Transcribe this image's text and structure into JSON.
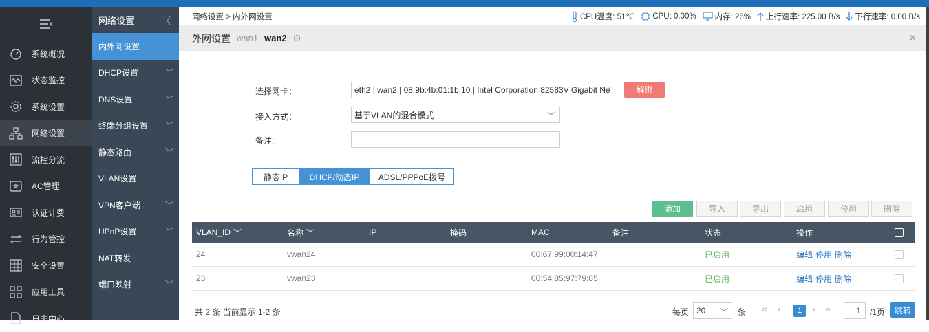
{
  "sidebar": {
    "items": [
      {
        "label": "系统概况",
        "icon": "dashboard-icon"
      },
      {
        "label": "状态监控",
        "icon": "monitor-icon"
      },
      {
        "label": "系统设置",
        "icon": "gear-icon"
      },
      {
        "label": "网络设置",
        "icon": "network-icon"
      },
      {
        "label": "流控分流",
        "icon": "sliders-icon"
      },
      {
        "label": "AC管理",
        "icon": "wifi-icon"
      },
      {
        "label": "认证计费",
        "icon": "id-card-icon"
      },
      {
        "label": "行为管控",
        "icon": "arrows-icon"
      },
      {
        "label": "安全设置",
        "icon": "grid-icon"
      },
      {
        "label": "应用工具",
        "icon": "apps-icon"
      },
      {
        "label": "日志中心",
        "icon": "document-icon"
      }
    ]
  },
  "submenu": {
    "title": "网络设置",
    "items": [
      {
        "label": "内外网设置"
      },
      {
        "label": "DHCP设置"
      },
      {
        "label": "DNS设置"
      },
      {
        "label": "终端分组设置"
      },
      {
        "label": "静态路由"
      },
      {
        "label": "VLAN设置"
      },
      {
        "label": "VPN客户端"
      },
      {
        "label": "UPnP设置"
      },
      {
        "label": "NAT转发"
      },
      {
        "label": "端口映射"
      }
    ]
  },
  "topbar": {
    "breadcrumb": "网络设置 > 内外网设置",
    "cpu_temp": "CPU温度: 51℃",
    "cpu": "CPU: 0.00%",
    "memory": "内存: 26%",
    "upload": "上行速率: 225.00 B/s",
    "download": "下行速率: 0.00 B/s"
  },
  "panel": {
    "title": "外网设置",
    "tab1": "wan1",
    "tab2": "wan2",
    "add_symbol": "⊕",
    "close_symbol": "×"
  },
  "form": {
    "nic_label": "选择网卡：",
    "nic_value": "eth2 | wan2 | 08:9b:4b:01:1b:10 | Intel Corporation 82583V Gigabit Ne",
    "unbind_label": "解绑",
    "access_label": "接入方式：",
    "access_value": "基于VLAN的混合模式",
    "remark_label": "备注:",
    "remark_value": ""
  },
  "modes": [
    "静态IP",
    "DHCP/动态IP",
    "ADSL/PPPoE拨号"
  ],
  "actions": {
    "add": "添加",
    "import": "导入",
    "export": "导出",
    "enable": "启用",
    "disable": "停用",
    "delete": "删除"
  },
  "table": {
    "headers": [
      "VLAN_ID",
      "名称",
      "IP",
      "掩码",
      "MAC",
      "备注",
      "状态",
      "操作"
    ],
    "rows": [
      {
        "id": "24",
        "name": "vwan24",
        "ip": "",
        "mask": "",
        "mac": "00:67:99:00:14:47",
        "remark": "",
        "status": "已启用",
        "ops": [
          "编辑",
          "停用",
          "删除"
        ]
      },
      {
        "id": "23",
        "name": "vwan23",
        "ip": "",
        "mask": "",
        "mac": "00:54:85:97:79:85",
        "remark": "",
        "status": "已启用",
        "ops": [
          "编辑",
          "停用",
          "删除"
        ]
      }
    ]
  },
  "footer": {
    "summary": "共 2 条 当前显示 1-2 条",
    "per_page_label": "每页",
    "per_page_value": "20",
    "unit": "条",
    "current_page": "1",
    "page_input": "1",
    "total_pages": "/1页",
    "jump_label": "跳转"
  },
  "colors": {
    "accent": "#4593d6",
    "sidebar": "#2c3037",
    "submenu": "#3a4757",
    "add_button": "#5cc08e",
    "unbind_button": "#f07a74",
    "table_header": "#485565"
  }
}
